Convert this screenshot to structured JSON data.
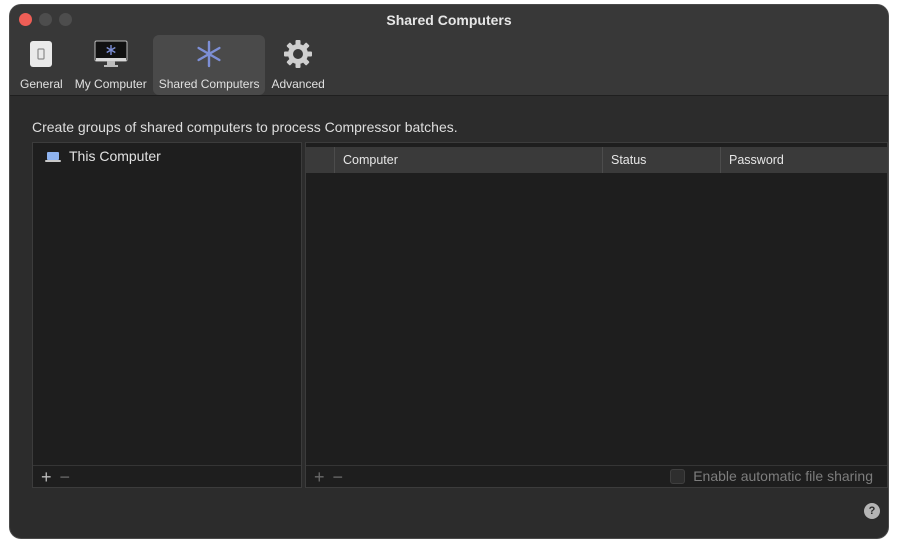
{
  "window": {
    "title": "Shared Computers"
  },
  "tabs": [
    {
      "label": "General",
      "icon": "switch-icon"
    },
    {
      "label": "My Computer",
      "icon": "monitor-icon"
    },
    {
      "label": "Shared Computers",
      "icon": "network-icon",
      "active": true
    },
    {
      "label": "Advanced",
      "icon": "gear-icon"
    }
  ],
  "main": {
    "description": "Create groups of shared computers to process Compressor batches.",
    "groups": [
      {
        "label": "This Computer",
        "icon": "laptop-icon"
      }
    ],
    "table": {
      "columns": [
        "",
        "Computer",
        "Status",
        "Password"
      ]
    },
    "left_controls": {
      "add": "+",
      "remove": "−"
    },
    "right_controls": {
      "add": "+",
      "remove": "−"
    },
    "file_sharing": {
      "label": "Enable automatic file sharing",
      "checked": false
    },
    "help": "?"
  },
  "colors": {
    "close": "#ee5e56",
    "active_tab": "#4a4a4a",
    "accent_icon": "#7d8fd6"
  }
}
